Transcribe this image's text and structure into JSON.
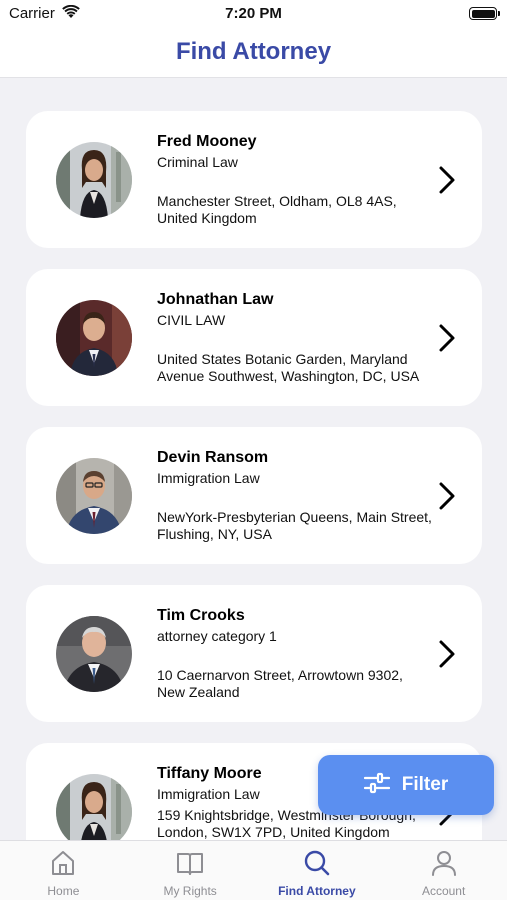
{
  "status_bar": {
    "carrier": "Carrier",
    "time": "7:20 PM"
  },
  "header": {
    "title": "Find Attorney"
  },
  "attorneys": [
    {
      "name": "Fred Mooney",
      "category": "Criminal Law",
      "address": "Manchester Street, Oldham, OL8 4AS, United Kingdom"
    },
    {
      "name": "Johnathan Law",
      "category": "CIVIL LAW",
      "address": "United States Botanic Garden, Maryland Avenue Southwest, Washington, DC, USA"
    },
    {
      "name": "Devin Ransom",
      "category": "Immigration Law",
      "address": "NewYork-Presbyterian Queens, Main Street, Flushing, NY, USA"
    },
    {
      "name": "Tim Crooks",
      "category": "attorney category 1",
      "address": "10 Caernarvon Street, Arrowtown 9302, New Zealand"
    },
    {
      "name": "Tiffany Moore",
      "category": "Immigration Law",
      "address": "159 Knightsbridge, Westminster Borough, London, SW1X 7PD, United Kingdom"
    }
  ],
  "filter_button": {
    "label": "Filter"
  },
  "tab_bar": {
    "tabs": [
      {
        "label": "Home",
        "icon": "home-icon"
      },
      {
        "label": "My Rights",
        "icon": "book-icon"
      },
      {
        "label": "Find Attorney",
        "icon": "search-icon"
      },
      {
        "label": "Account",
        "icon": "person-icon"
      }
    ],
    "active_index": 2
  },
  "colors": {
    "accent": "#3a4aa6",
    "filter_button": "#5b8ff0",
    "background": "#f1f1f5",
    "inactive_tab": "#8e8e93"
  }
}
